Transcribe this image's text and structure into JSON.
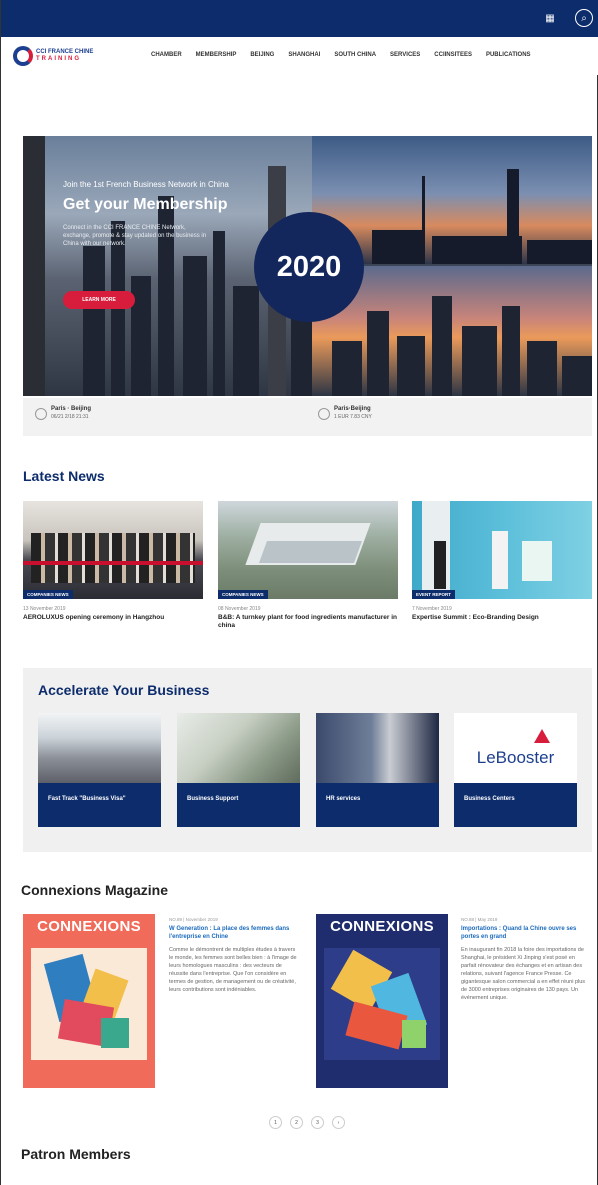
{
  "topbar": {
    "icons": [
      "menu-grid-icon",
      "search-icon"
    ]
  },
  "logo": {
    "line1": "CCI FRANCE CHINE",
    "line2": "TRAINING"
  },
  "nav": {
    "items": [
      "CHAMBER",
      "MEMBERSHIP",
      "BEIJING",
      "SHANGHAI",
      "SOUTH CHINA",
      "SERVICES",
      "CCIINSITEES",
      "PUBLICATIONS"
    ]
  },
  "hero": {
    "kicker": "Join the 1st French Business Network in China",
    "title": "Get your Membership",
    "description": "Connect in the CCI FRANCE CHINE Network, exchange, promote & stay updated on the business in China with our network.",
    "cta": "LEARN MORE",
    "year": "2020"
  },
  "clocks": [
    {
      "city": "Paris · Beijing",
      "time": "06/21 2/18 21:31"
    },
    {
      "city": "Paris·Beijing",
      "time": "1 EUR 7.83 CNY"
    }
  ],
  "latest_news": {
    "title": "Latest News",
    "items": [
      {
        "tag": "COMPANIES NEWS",
        "date": "13 November 2019",
        "title": "AEROLUXUS opening ceremony in Hangzhou"
      },
      {
        "tag": "COMPANIES NEWS",
        "date": "08 November 2019",
        "title": "B&B: A turnkey plant for food ingredients manufacturer in china"
      },
      {
        "tag": "EVENT REPORT",
        "date": "7 November 2019",
        "title": "Expertise Summit : Eco-Branding Design"
      }
    ]
  },
  "accelerate": {
    "title": "Accelerate Your Business",
    "cards": [
      {
        "label": "Fast Track \"Business Visa\""
      },
      {
        "label": "Business Support"
      },
      {
        "label": "HR services"
      },
      {
        "label": "Business Centers",
        "logo": "LeBooster"
      }
    ]
  },
  "magazine": {
    "title": "Connexions Magazine",
    "issues": [
      {
        "cover_title": "CONNEXIONS",
        "date": "NO.89 | November 2019",
        "title": "W Generation : La place des femmes dans l'entreprise en Chine",
        "body": "Comme le démontrent de multiples études à travers le monde, les femmes sont belles bien : à l'image de leurs homologues masculins : des vecteurs de réussite dans l'entreprise. Que l'on considère en termes de gestion, de management ou de créativité, leurs contributions sont indéniables."
      },
      {
        "cover_title": "CONNEXIONS",
        "date": "NO.88 | May 2019",
        "title": "Importations : Quand la Chine ouvre ses portes en grand",
        "body": "En inaugurant fin 2018 la foire des importations de Shanghai, le président Xi Jinping s'est posé en parfait rénovateur des échanges et en artisan des relations, suivant l'agence France Presse. Ce gigantesque salon commercial a en effet réuni plus de 3000 entreprises originaires de 130 pays. Un événement unique."
      }
    ],
    "pages": [
      "1",
      "2",
      "3",
      "›"
    ]
  },
  "patron": {
    "title": "Patron Members"
  }
}
